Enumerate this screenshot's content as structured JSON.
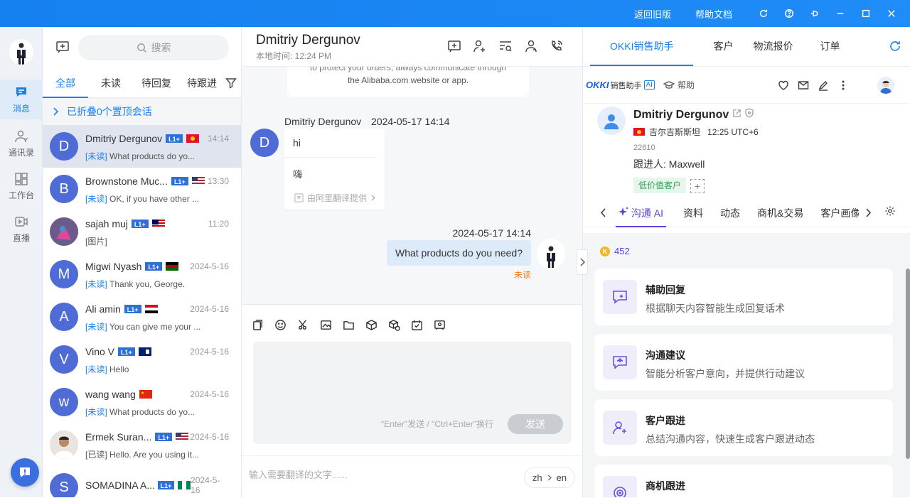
{
  "topbar": {
    "back_old": "返回旧版",
    "help_docs": "帮助文档"
  },
  "leftnav": {
    "items": [
      {
        "label": "消息",
        "icon": "message-icon"
      },
      {
        "label": "通讯录",
        "icon": "contacts-icon"
      },
      {
        "label": "工作台",
        "icon": "workbench-icon"
      },
      {
        "label": "直播",
        "icon": "live-icon"
      }
    ]
  },
  "convlist": {
    "search_placeholder": "搜索",
    "tabs": [
      "全部",
      "未读",
      "待回复",
      "待跟进"
    ],
    "pinned": "已折叠0个置顶会话",
    "items": [
      {
        "initial": "D",
        "color": "#4e6bd6",
        "name": "Dmitriy Dergunov",
        "level": "L1+",
        "flag": "kg",
        "time": "14:14",
        "tag": "[未读]",
        "msg": "What products do yo..."
      },
      {
        "initial": "B",
        "color": "#4e6bd6",
        "name": "Brownstone Muc...",
        "level": "L1+",
        "flag": "us",
        "time": "13:30",
        "tag": "[未读]",
        "msg": "OK, if you have other ..."
      },
      {
        "initial": "",
        "color": "#8b7fa8",
        "name": "sajah muj",
        "level": "L1+",
        "flag": "my",
        "time": "11:20",
        "tag": "",
        "msg": "[图片]"
      },
      {
        "initial": "M",
        "color": "#4e6bd6",
        "name": "Migwi Nyash",
        "level": "L1+",
        "flag": "ke",
        "time": "2024-5-16",
        "tag": "[未读]",
        "msg": "Thank you, George."
      },
      {
        "initial": "A",
        "color": "#4e6bd6",
        "name": "Ali amin",
        "level": "L1+",
        "flag": "eg",
        "time": "2024-5-16",
        "tag": "[未读]",
        "msg": "You can give me your ..."
      },
      {
        "initial": "V",
        "color": "#4e6bd6",
        "name": "Vino V",
        "level": "L1+",
        "flag": "ky",
        "time": "2024-5-16",
        "tag": "[未读]",
        "msg": "Hello"
      },
      {
        "initial": "w",
        "color": "#4e6bd6",
        "name": "wang wang",
        "level": "",
        "flag": "cn",
        "time": "2024-5-16",
        "tag": "[未读]",
        "msg": "What products do yo..."
      },
      {
        "initial": "",
        "color": "#c9b9a8",
        "name": "Ermek Suran...",
        "level": "L1+",
        "flag": "us",
        "time": "2024-5-16",
        "tag": "[已读]",
        "msg": "Hello. Are you using it..."
      },
      {
        "initial": "S",
        "color": "#4e6bd6",
        "name": "SOMADINA A...",
        "level": "L1+",
        "flag": "ng",
        "time": "2024-5-16",
        "tag": "",
        "msg": ""
      }
    ]
  },
  "chat": {
    "title": "Dmitriy Dergunov",
    "local_time": "本地时间: 12:24 PM",
    "notice_line1": "to protect your orders, always communicate through",
    "notice_line2": "the Alibaba.com website or app.",
    "incoming": {
      "initial": "D",
      "sender": "Dmitriy Dergunov",
      "time": "2024-05-17 14:14",
      "text": "hi",
      "translation": "嗨",
      "translated_by": "由阿里翻译提供"
    },
    "outgoing": {
      "time": "2024-05-17 14:14",
      "text": "What products do you need?",
      "status": "未读"
    },
    "send_hint": "\"Enter\"发送 / \"Ctrl+Enter\"换行",
    "send": "发送",
    "translate_placeholder": "输入需要翻译的文字......",
    "lang_from": "zh",
    "lang_to": "en"
  },
  "right": {
    "tabs": [
      "OKKI销售助手",
      "客户",
      "物流报价",
      "订单"
    ],
    "brand": "OKKI",
    "brand_sub": "销售助手",
    "ai": "AI",
    "help": "帮助",
    "customer": {
      "name": "Dmitriy Dergunov",
      "country": "吉尔吉斯斯坦",
      "local": "12:25 UTC+6",
      "id": "22610",
      "owner": "跟进人: Maxwell",
      "tag": "低价值客户"
    },
    "subtabs": [
      "沟通 AI",
      "资料",
      "动态",
      "商机&交易",
      "客户画像"
    ],
    "credits": "452",
    "cards": [
      {
        "title": "辅助回复",
        "desc": "根据聊天内容智能生成回复话术"
      },
      {
        "title": "沟通建议",
        "desc": "智能分析客户意向，并提供行动建议"
      },
      {
        "title": "客户跟进",
        "desc": "总结沟通内容，快速生成客户跟进动态"
      },
      {
        "title": "商机跟进",
        "desc": ""
      }
    ]
  }
}
